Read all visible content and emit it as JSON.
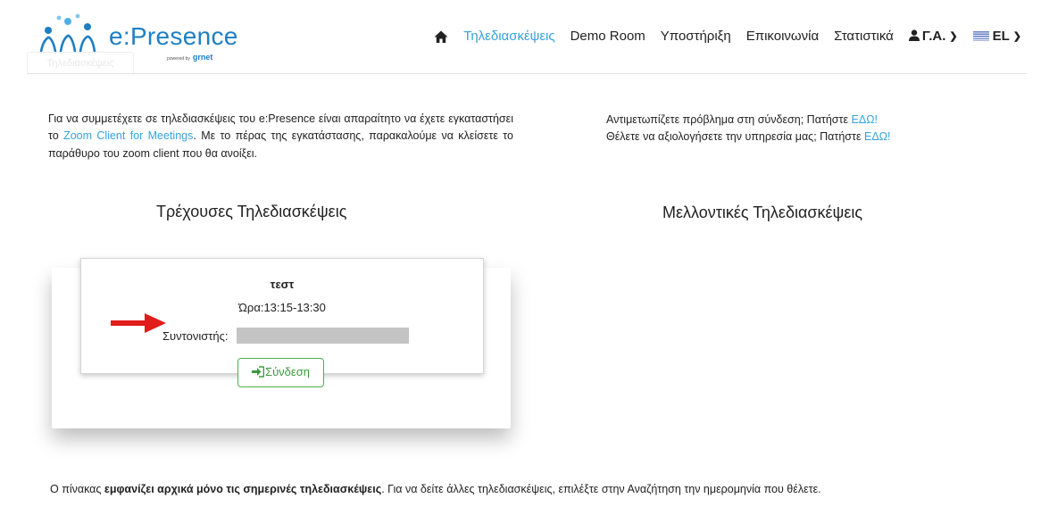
{
  "logo": {
    "brand": "e:Presence",
    "powered": "powered by",
    "org": "grnet"
  },
  "nav": {
    "items": [
      {
        "label": "Τηλεδιασκέψεις",
        "active": true
      },
      {
        "label": "Demo Room"
      },
      {
        "label": "Υποστήριξη"
      },
      {
        "label": "Επικοινωνία"
      },
      {
        "label": "Στατιστικά"
      }
    ],
    "user_label": "Γ.Α.",
    "language_label": "EL"
  },
  "tab_ghost_label": "Τηλεδιασκέψεις",
  "intro": {
    "text_before": "Για να συμμετέχετε σε τηλεδιασκέψεις του e:Presence είναι απαραίτητο να έχετε εγκαταστήσει το ",
    "link": "Zoom Client for Meetings",
    "text_after": ". Με το πέρας της εγκατάστασης, παρακαλούμε να κλείσετε το παράθυρο του zoom client που θα ανοίξει."
  },
  "help": {
    "problem_text": "Αντιμετωπίζετε πρόβλημα στη σύνδεση; Πατήστε ",
    "problem_link": "ΕΔΩ!",
    "rate_text": "Θέλετε να αξιολογήσετε την υπηρεσία μας; Πατήστε ",
    "rate_link": "ΕΔΩ!"
  },
  "current_heading": "Τρέχουσες Τηλεδιασκέψεις",
  "future_heading": "Μελλοντικές Τηλεδιασκέψεις",
  "meeting": {
    "title": "τεστ",
    "time_label": "Ώρα:",
    "time_value": "13:15-13:30",
    "moderator_label": "Συντονιστής:",
    "connect_label": "Σύνδεση"
  },
  "footer_note": {
    "before": "Ο πίνακας ",
    "bold": "εμφανίζει αρχικά μόνο τις σημερινές τηλεδιασκέψεις",
    "after": ". Για να δείτε άλλες τηλεδιασκέψεις, επιλέξτε στην Αναζήτηση την ημερομηνία που θέλετε."
  },
  "colors": {
    "accent": "#36a3d9",
    "brand": "#1e7fc3",
    "success": "#4caf50",
    "arrow": "#e21b1b"
  },
  "icons": {
    "home": "home-icon",
    "user": "user-icon",
    "chevron": "chevron-down-icon",
    "flag": "greek-flag-icon",
    "signin": "sign-in-icon",
    "arrow": "red-arrow-icon"
  }
}
